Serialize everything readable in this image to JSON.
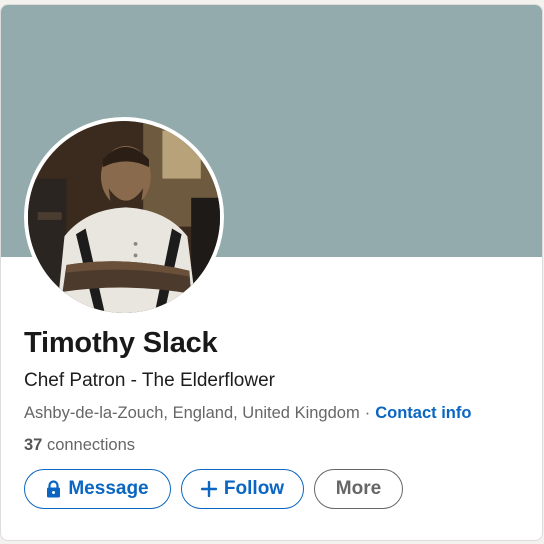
{
  "profile": {
    "name": "Timothy Slack",
    "headline": "Chef Patron - The Elderflower",
    "location": "Ashby-de-la-Zouch, England, United Kingdom",
    "separator": "·",
    "contact_info_label": "Contact info",
    "connections_count": "37",
    "connections_label": "connections"
  },
  "actions": {
    "message_label": "Message",
    "follow_label": "Follow",
    "more_label": "More"
  },
  "colors": {
    "banner": "#93abad",
    "accent": "#0a66c2",
    "muted": "#666666"
  },
  "icons": {
    "message": "lock-icon",
    "follow": "plus-icon"
  }
}
